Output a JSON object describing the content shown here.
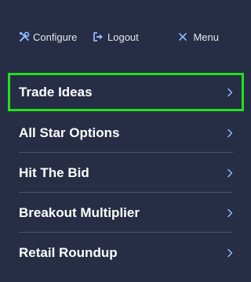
{
  "topbar": {
    "configure_label": "Configure",
    "configure_icon": "tools-icon",
    "logout_label": "Logout",
    "logout_icon": "logout-icon",
    "menu_label": "Menu",
    "menu_icon": "close-icon"
  },
  "menu": {
    "items": [
      {
        "label": "Trade Ideas",
        "active": true
      },
      {
        "label": "All Star Options",
        "active": false
      },
      {
        "label": "Hit The Bid",
        "active": false
      },
      {
        "label": "Breakout Multiplier",
        "active": false
      },
      {
        "label": "Retail Roundup",
        "active": false
      }
    ]
  },
  "colors": {
    "background": "#262d44",
    "active_outline": "#22e11a",
    "divider": "#4b5370",
    "icon_accent": "#8fb8ff"
  }
}
